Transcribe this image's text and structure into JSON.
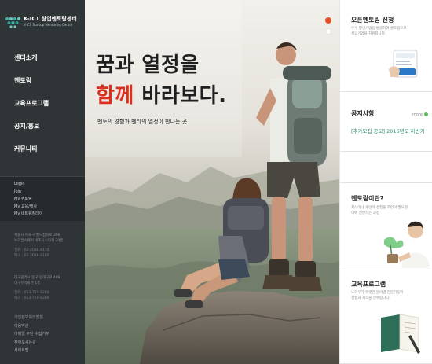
{
  "logo": {
    "title": "K-ICT 창업멘토링센터",
    "subtitle": "K-ICT Startup Mentoring Centre"
  },
  "nav": {
    "items": [
      {
        "label": "센터소개"
      },
      {
        "label": "멘토링"
      },
      {
        "label": "교육프로그램"
      },
      {
        "label": "공지/홍보"
      },
      {
        "label": "커뮤니티"
      }
    ]
  },
  "sublinks": [
    "Login",
    "Join",
    "My 멘토링",
    "My 교육/행사",
    "My 네트워킹데이"
  ],
  "address": {
    "seoul": {
      "lines": [
        "서울시 마포구 월드컵북로 396",
        "누리꿈스퀘어 비즈니스타워 20층"
      ],
      "phone": "전화 : 02-2038-4170",
      "fax": "팩스 : 02-2038-4180"
    },
    "daegu": {
      "lines": [
        "대구광역시 동구 동대구로 489",
        "대구무역회관 1층"
      ],
      "phone": "전화 : 053-759-6280",
      "fax": "팩스 : 053-759-6289"
    }
  },
  "footer_links": [
    "개인정보처리방침",
    "이용약관",
    "이메일 무단 수집거부",
    "찾아오시는길",
    "사이트맵"
  ],
  "hero": {
    "line1": "꿈과 열정을",
    "line2_accent": "함께",
    "line2_rest": " 바라보다.",
    "subtitle": "멘토의 경험과 멘티의 열정이 만나는 곳"
  },
  "right": {
    "apply": {
      "title": "오픈멘토링 신청",
      "desc": [
        "우수 청년기업을 발굴하여 멘토링으로",
        "성공기업을 지원합니다."
      ]
    },
    "notice": {
      "title": "공지사항",
      "more": "more",
      "item": "[추가모집 공고] 2016년도 하반기"
    },
    "mentoring": {
      "title": "멘토링이란?",
      "desc": [
        "지식이나 개인의 경험을 조언이 필요한",
        "이에 전달하는 과정"
      ]
    },
    "edu": {
      "title": "교육프로그램",
      "desc": [
        "노하우가 뚜렷한 분야별 전문가들이",
        "경험과 지식을 전수합니다."
      ]
    }
  },
  "colors": {
    "sidebar": "#2f3436",
    "accent_red": "#d9311d",
    "notice_green": "#2d8f6f",
    "active_dot": "#e8542a"
  }
}
